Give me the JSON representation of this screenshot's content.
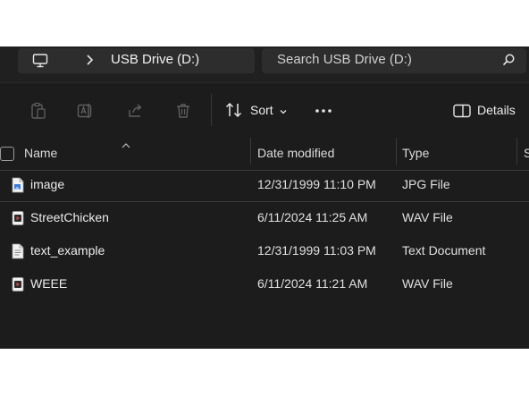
{
  "address": {
    "location": "USB Drive (D:)"
  },
  "search": {
    "placeholder": "Search USB Drive (D:)"
  },
  "toolbar": {
    "sort_label": "Sort",
    "details_label": "Details"
  },
  "columns": {
    "name": "Name",
    "date": "Date modified",
    "type": "Type",
    "size": "S"
  },
  "files": [
    {
      "name": "image",
      "date": "12/31/1999 11:10 PM",
      "type": "JPG File",
      "icon": "image-file-icon"
    },
    {
      "name": "StreetChicken",
      "date": "6/11/2024 11:25 AM",
      "type": "WAV File",
      "icon": "audio-file-icon"
    },
    {
      "name": "text_example",
      "date": "12/31/1999 11:03 PM",
      "type": "Text Document",
      "icon": "text-file-icon"
    },
    {
      "name": "WEEE",
      "date": "6/11/2024 11:21 AM",
      "type": "WAV File",
      "icon": "audio-file-icon"
    }
  ]
}
